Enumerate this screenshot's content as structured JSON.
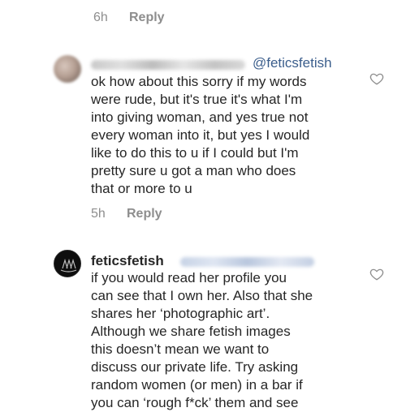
{
  "top_meta": {
    "time": "6h",
    "reply": "Reply"
  },
  "comment1": {
    "mention": "@feticsfetish",
    "text": "ok how about this sorry if my words\nwere rude, but it's true it's what I'm\ninto giving woman, and yes true not\nevery woman into it, but yes I would\nlike to do this to u if I could but I'm\npretty sure u got a man who does\nthat or more to u",
    "time": "5h",
    "reply": "Reply",
    "like_icon": "heart-outline-icon"
  },
  "comment2": {
    "username": "feticsfetish",
    "text": "if you would read her profile you\ncan see that I own her. Also that she\nshares her ‘photographic art’.\nAlthough we share fetish images\nthis doesn’t mean we want to\ndiscuss our private life. Try asking\nrandom women (or men) in a bar if\nyou can ‘rough f*ck’ them and see",
    "like_icon": "heart-outline-icon"
  }
}
